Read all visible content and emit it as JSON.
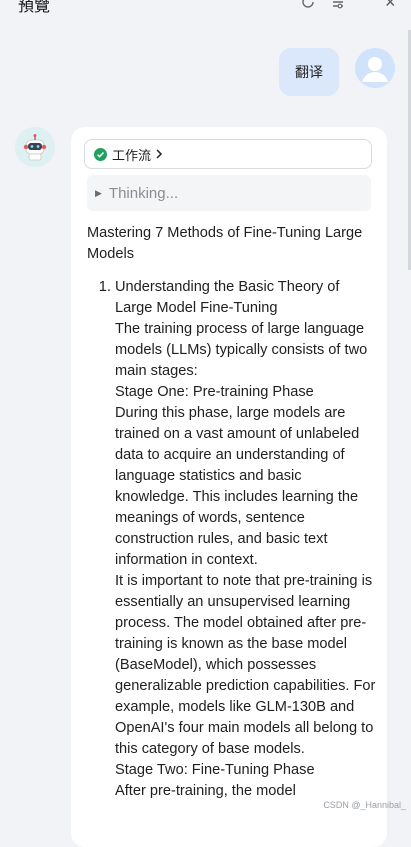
{
  "header": {
    "title": "預覽",
    "refresh_icon": "refresh-icon",
    "settings_icon": "settings-icon",
    "close_label": "×"
  },
  "user_message": {
    "text": "翻译",
    "avatar_icon": "user-avatar-icon"
  },
  "assistant": {
    "avatar_icon": "robot-avatar-icon",
    "workflow_label": "工作流",
    "workflow_status_color": "#20a162",
    "thinking_label": "Thinking...",
    "heading": "Mastering 7 Methods of Fine-Tuning Large Models",
    "items": [
      {
        "lines": [
          "Understanding the Basic Theory of Large Model Fine-Tuning",
          "The training process of large language models (LLMs) typically consists of two main stages:",
          "Stage One: Pre-training Phase",
          "During this phase, large models are trained on a vast amount of unlabeled data to acquire an understanding of language statistics and basic knowledge. This includes learning the meanings of words, sentence construction rules, and basic text information in context.",
          "It is important to note that pre-training is essentially an unsupervised learning process. The model obtained after pre-training is known as the base model (BaseModel), which possesses generalizable prediction capabilities. For example, models like GLM-130B and OpenAI's four main models all belong to this category of base models.",
          "Stage Two: Fine-Tuning Phase",
          "After pre-training, the model"
        ]
      }
    ]
  },
  "watermark": "CSDN @_Hannibal_"
}
